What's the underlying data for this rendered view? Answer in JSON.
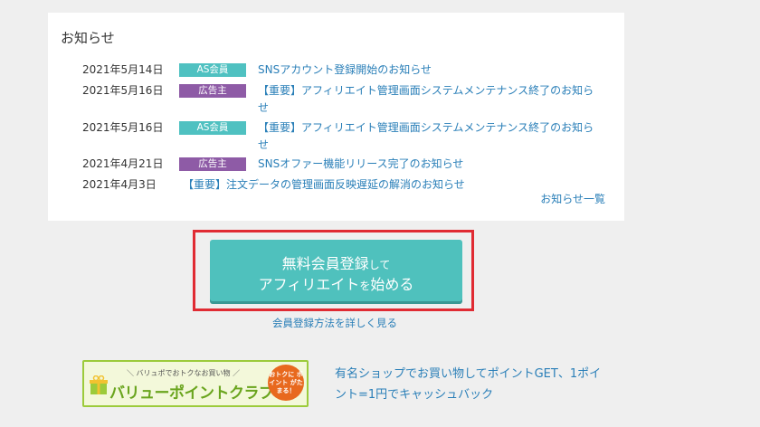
{
  "news": {
    "title": "お知らせ",
    "more_label": "お知らせ一覧",
    "items": [
      {
        "date": "2021年5月14日",
        "badge": "AS会員",
        "badge_type": "as",
        "text": "SNSアカウント登録開始のお知らせ"
      },
      {
        "date": "2021年5月16日",
        "badge": "広告主",
        "badge_type": "ad",
        "text": "【重要】アフィリエイト管理画面システムメンテナンス終了のお知らせ"
      },
      {
        "date": "2021年5月16日",
        "badge": "AS会員",
        "badge_type": "as",
        "text": "【重要】アフィリエイト管理画面システムメンテナンス終了のお知らせ"
      },
      {
        "date": "2021年4月21日",
        "badge": "広告主",
        "badge_type": "ad",
        "text": "SNSオファー機能リリース完了のお知らせ"
      },
      {
        "date": "2021年4月3日",
        "badge": "",
        "badge_type": "",
        "text": "【重要】注文データの管理画面反映遅延の解消のお知らせ"
      }
    ]
  },
  "cta": {
    "line1_main": "無料会員登録",
    "line1_small": "して",
    "line2_main": "アフィリエイト",
    "line2_small": "を",
    "line2_end": "始める",
    "register_link": "会員登録方法を詳しく見る"
  },
  "club": {
    "banner_sub": "＼ バリュポでおトクなお買い物 ／",
    "banner_name": "バリューポイントクラブ",
    "seal_text": "おトクに ポイント がたまる！",
    "description": "有名ショップでお買い物してポイントGET、1ポイント=1円でキャッシュバック"
  },
  "colors": {
    "as_badge": "#4fc1c1",
    "ad_badge": "#8e5ba6",
    "cta": "#4fc1bd",
    "highlight_border": "#e02b33",
    "link": "#2a7fb8"
  }
}
